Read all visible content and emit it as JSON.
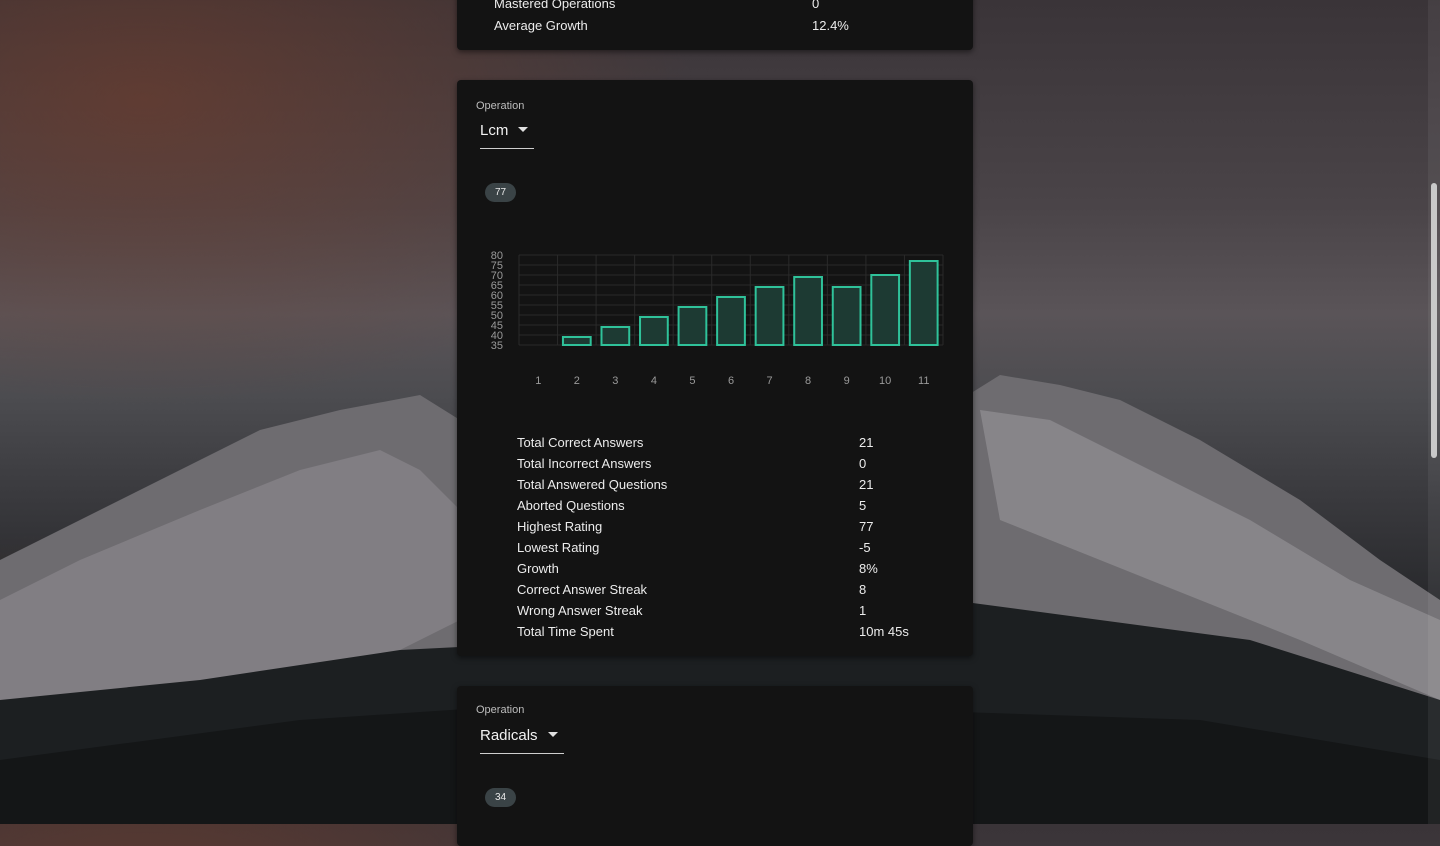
{
  "summary": {
    "rows": [
      {
        "label": "Mastered Operations",
        "value": "0"
      },
      {
        "label": "Average Growth",
        "value": "12.4%"
      }
    ]
  },
  "operation_cards": [
    {
      "operation_label": "Operation",
      "selected_operation": "Lcm",
      "current_rating_badge": "77",
      "stats": [
        {
          "label": "Total Correct Answers",
          "value": "21"
        },
        {
          "label": "Total Incorrect Answers",
          "value": "0"
        },
        {
          "label": "Total Answered Questions",
          "value": "21"
        },
        {
          "label": "Aborted Questions",
          "value": "5"
        },
        {
          "label": "Highest Rating",
          "value": "77"
        },
        {
          "label": "Lowest Rating",
          "value": "-5"
        },
        {
          "label": "Growth",
          "value": "8%"
        },
        {
          "label": "Correct Answer Streak",
          "value": "8"
        },
        {
          "label": "Wrong Answer Streak",
          "value": "1"
        },
        {
          "label": "Total Time Spent",
          "value": "10m 45s"
        }
      ]
    },
    {
      "operation_label": "Operation",
      "selected_operation": "Radicals",
      "current_rating_badge": "34"
    }
  ],
  "chart_data": {
    "type": "bar",
    "categories": [
      "1",
      "2",
      "3",
      "4",
      "5",
      "6",
      "7",
      "8",
      "9",
      "10",
      "11"
    ],
    "values": [
      null,
      39,
      44,
      49,
      54,
      59,
      64,
      69,
      64,
      70,
      77
    ],
    "yticks": [
      "35",
      "40",
      "45",
      "50",
      "55",
      "60",
      "65",
      "70",
      "75",
      "80"
    ],
    "ylim": [
      35,
      80
    ],
    "grid": true,
    "bar_color": "#2fc29a",
    "bar_fill": "#1d3a33"
  }
}
